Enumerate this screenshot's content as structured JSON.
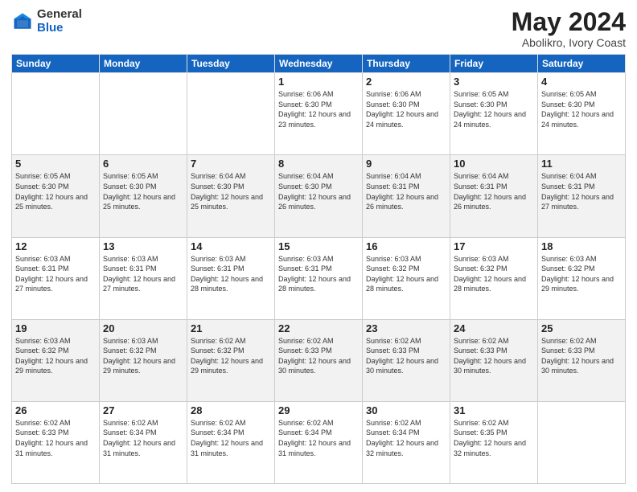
{
  "header": {
    "logo_general": "General",
    "logo_blue": "Blue",
    "month_title": "May 2024",
    "location": "Abolikro, Ivory Coast"
  },
  "weekdays": [
    "Sunday",
    "Monday",
    "Tuesday",
    "Wednesday",
    "Thursday",
    "Friday",
    "Saturday"
  ],
  "weeks": [
    [
      {
        "day": "",
        "sunrise": "",
        "sunset": "",
        "daylight": ""
      },
      {
        "day": "",
        "sunrise": "",
        "sunset": "",
        "daylight": ""
      },
      {
        "day": "",
        "sunrise": "",
        "sunset": "",
        "daylight": ""
      },
      {
        "day": "1",
        "sunrise": "Sunrise: 6:06 AM",
        "sunset": "Sunset: 6:30 PM",
        "daylight": "Daylight: 12 hours and 23 minutes."
      },
      {
        "day": "2",
        "sunrise": "Sunrise: 6:06 AM",
        "sunset": "Sunset: 6:30 PM",
        "daylight": "Daylight: 12 hours and 24 minutes."
      },
      {
        "day": "3",
        "sunrise": "Sunrise: 6:05 AM",
        "sunset": "Sunset: 6:30 PM",
        "daylight": "Daylight: 12 hours and 24 minutes."
      },
      {
        "day": "4",
        "sunrise": "Sunrise: 6:05 AM",
        "sunset": "Sunset: 6:30 PM",
        "daylight": "Daylight: 12 hours and 24 minutes."
      }
    ],
    [
      {
        "day": "5",
        "sunrise": "Sunrise: 6:05 AM",
        "sunset": "Sunset: 6:30 PM",
        "daylight": "Daylight: 12 hours and 25 minutes."
      },
      {
        "day": "6",
        "sunrise": "Sunrise: 6:05 AM",
        "sunset": "Sunset: 6:30 PM",
        "daylight": "Daylight: 12 hours and 25 minutes."
      },
      {
        "day": "7",
        "sunrise": "Sunrise: 6:04 AM",
        "sunset": "Sunset: 6:30 PM",
        "daylight": "Daylight: 12 hours and 25 minutes."
      },
      {
        "day": "8",
        "sunrise": "Sunrise: 6:04 AM",
        "sunset": "Sunset: 6:30 PM",
        "daylight": "Daylight: 12 hours and 26 minutes."
      },
      {
        "day": "9",
        "sunrise": "Sunrise: 6:04 AM",
        "sunset": "Sunset: 6:31 PM",
        "daylight": "Daylight: 12 hours and 26 minutes."
      },
      {
        "day": "10",
        "sunrise": "Sunrise: 6:04 AM",
        "sunset": "Sunset: 6:31 PM",
        "daylight": "Daylight: 12 hours and 26 minutes."
      },
      {
        "day": "11",
        "sunrise": "Sunrise: 6:04 AM",
        "sunset": "Sunset: 6:31 PM",
        "daylight": "Daylight: 12 hours and 27 minutes."
      }
    ],
    [
      {
        "day": "12",
        "sunrise": "Sunrise: 6:03 AM",
        "sunset": "Sunset: 6:31 PM",
        "daylight": "Daylight: 12 hours and 27 minutes."
      },
      {
        "day": "13",
        "sunrise": "Sunrise: 6:03 AM",
        "sunset": "Sunset: 6:31 PM",
        "daylight": "Daylight: 12 hours and 27 minutes."
      },
      {
        "day": "14",
        "sunrise": "Sunrise: 6:03 AM",
        "sunset": "Sunset: 6:31 PM",
        "daylight": "Daylight: 12 hours and 28 minutes."
      },
      {
        "day": "15",
        "sunrise": "Sunrise: 6:03 AM",
        "sunset": "Sunset: 6:31 PM",
        "daylight": "Daylight: 12 hours and 28 minutes."
      },
      {
        "day": "16",
        "sunrise": "Sunrise: 6:03 AM",
        "sunset": "Sunset: 6:32 PM",
        "daylight": "Daylight: 12 hours and 28 minutes."
      },
      {
        "day": "17",
        "sunrise": "Sunrise: 6:03 AM",
        "sunset": "Sunset: 6:32 PM",
        "daylight": "Daylight: 12 hours and 28 minutes."
      },
      {
        "day": "18",
        "sunrise": "Sunrise: 6:03 AM",
        "sunset": "Sunset: 6:32 PM",
        "daylight": "Daylight: 12 hours and 29 minutes."
      }
    ],
    [
      {
        "day": "19",
        "sunrise": "Sunrise: 6:03 AM",
        "sunset": "Sunset: 6:32 PM",
        "daylight": "Daylight: 12 hours and 29 minutes."
      },
      {
        "day": "20",
        "sunrise": "Sunrise: 6:03 AM",
        "sunset": "Sunset: 6:32 PM",
        "daylight": "Daylight: 12 hours and 29 minutes."
      },
      {
        "day": "21",
        "sunrise": "Sunrise: 6:02 AM",
        "sunset": "Sunset: 6:32 PM",
        "daylight": "Daylight: 12 hours and 29 minutes."
      },
      {
        "day": "22",
        "sunrise": "Sunrise: 6:02 AM",
        "sunset": "Sunset: 6:33 PM",
        "daylight": "Daylight: 12 hours and 30 minutes."
      },
      {
        "day": "23",
        "sunrise": "Sunrise: 6:02 AM",
        "sunset": "Sunset: 6:33 PM",
        "daylight": "Daylight: 12 hours and 30 minutes."
      },
      {
        "day": "24",
        "sunrise": "Sunrise: 6:02 AM",
        "sunset": "Sunset: 6:33 PM",
        "daylight": "Daylight: 12 hours and 30 minutes."
      },
      {
        "day": "25",
        "sunrise": "Sunrise: 6:02 AM",
        "sunset": "Sunset: 6:33 PM",
        "daylight": "Daylight: 12 hours and 30 minutes."
      }
    ],
    [
      {
        "day": "26",
        "sunrise": "Sunrise: 6:02 AM",
        "sunset": "Sunset: 6:33 PM",
        "daylight": "Daylight: 12 hours and 31 minutes."
      },
      {
        "day": "27",
        "sunrise": "Sunrise: 6:02 AM",
        "sunset": "Sunset: 6:34 PM",
        "daylight": "Daylight: 12 hours and 31 minutes."
      },
      {
        "day": "28",
        "sunrise": "Sunrise: 6:02 AM",
        "sunset": "Sunset: 6:34 PM",
        "daylight": "Daylight: 12 hours and 31 minutes."
      },
      {
        "day": "29",
        "sunrise": "Sunrise: 6:02 AM",
        "sunset": "Sunset: 6:34 PM",
        "daylight": "Daylight: 12 hours and 31 minutes."
      },
      {
        "day": "30",
        "sunrise": "Sunrise: 6:02 AM",
        "sunset": "Sunset: 6:34 PM",
        "daylight": "Daylight: 12 hours and 32 minutes."
      },
      {
        "day": "31",
        "sunrise": "Sunrise: 6:02 AM",
        "sunset": "Sunset: 6:35 PM",
        "daylight": "Daylight: 12 hours and 32 minutes."
      },
      {
        "day": "",
        "sunrise": "",
        "sunset": "",
        "daylight": ""
      }
    ]
  ]
}
